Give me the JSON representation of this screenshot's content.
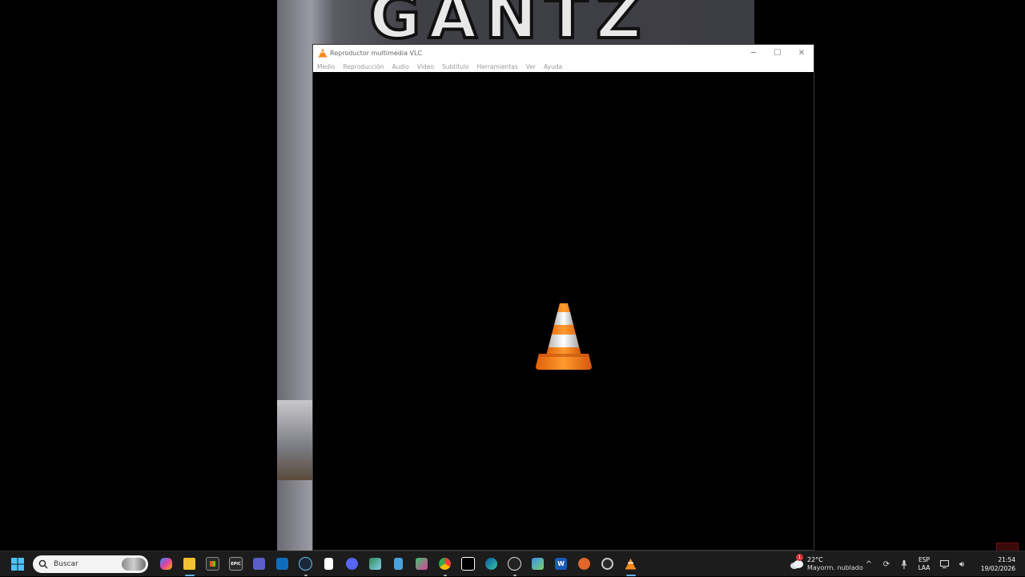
{
  "background": {
    "video_title_art": "GANTZ"
  },
  "window": {
    "title": "Reproductor multimedia VLC",
    "controls": {
      "minimize": "─",
      "maximize": "☐",
      "close": "✕"
    },
    "menu": [
      "Medio",
      "Reproducción",
      "Audio",
      "Vídeo",
      "Subtítulo",
      "Herramientas",
      "Ver",
      "Ayuda"
    ],
    "accent_color": "#f68a1e"
  },
  "taskbar": {
    "search_placeholder": "Buscar",
    "pinned_icons": [
      "copilot-icon",
      "file-explorer-icon",
      "microsoft-store-icon",
      "epic-games-icon",
      "teams-icon",
      "outlook-icon",
      "steam-icon",
      "notepad-icon",
      "discord-icon",
      "photos-icon",
      "notes-icon",
      "game-icon",
      "chrome-icon",
      "capcut-icon",
      "edge-icon",
      "obs-icon",
      "unity-icon",
      "word-icon",
      "bonfire-icon",
      "settings-icon",
      "vlc-icon"
    ],
    "epic_label": "EPIC",
    "word_label": "W",
    "weather": {
      "badge": "1",
      "temperature": "22°C",
      "condition": "Mayorm. nublado"
    },
    "tray": {
      "chevron": "^",
      "language_top": "ESP",
      "language_bottom": "LAA",
      "time": "21:54",
      "date": "19/02/2026"
    }
  }
}
